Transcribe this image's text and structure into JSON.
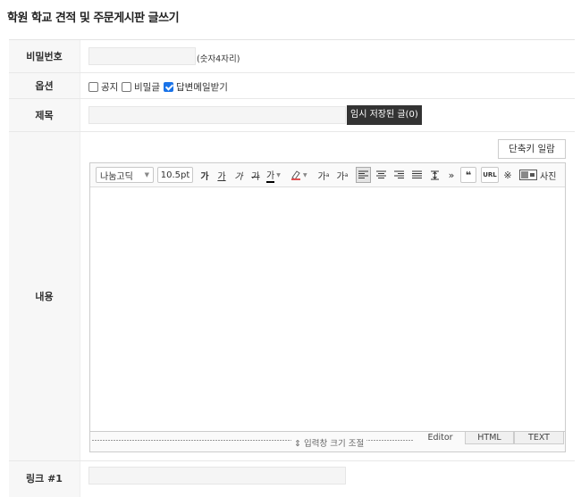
{
  "page": {
    "title": "학원 학교 견적 및 주문게시판 글쓰기"
  },
  "form": {
    "password": {
      "label": "비밀번호",
      "value": "",
      "hint": "(숫자4자리)"
    },
    "options": {
      "label": "옵션",
      "items": [
        {
          "label": "공지",
          "checked": false
        },
        {
          "label": "비밀글",
          "checked": false
        },
        {
          "label": "답변메일받기",
          "checked": true
        }
      ]
    },
    "subject": {
      "label": "제목",
      "value": "",
      "draft_button": "임시 저장된 글(0)"
    },
    "content": {
      "label": "내용",
      "shortcut_button": "단축키 일람",
      "toolbar": {
        "font": "나눔고딕",
        "size": "10.5pt",
        "bold": "가",
        "underline": "가",
        "italic": "가",
        "strike": "가",
        "font_color": "가",
        "bg_color_icon": "highlighter-icon",
        "superscript": "가",
        "superscript_mark": "a",
        "subscript": "가",
        "subscript_mark": "a",
        "more": "»",
        "quote": "❝",
        "url": "URL",
        "special_char": "※",
        "photo": "사진"
      },
      "resize_label": "⇕ 입력창 크기 조절",
      "mode_tabs": [
        "Editor",
        "HTML",
        "TEXT"
      ],
      "active_mode": "Editor"
    },
    "link": {
      "label": "링크 #1",
      "value": ""
    }
  }
}
